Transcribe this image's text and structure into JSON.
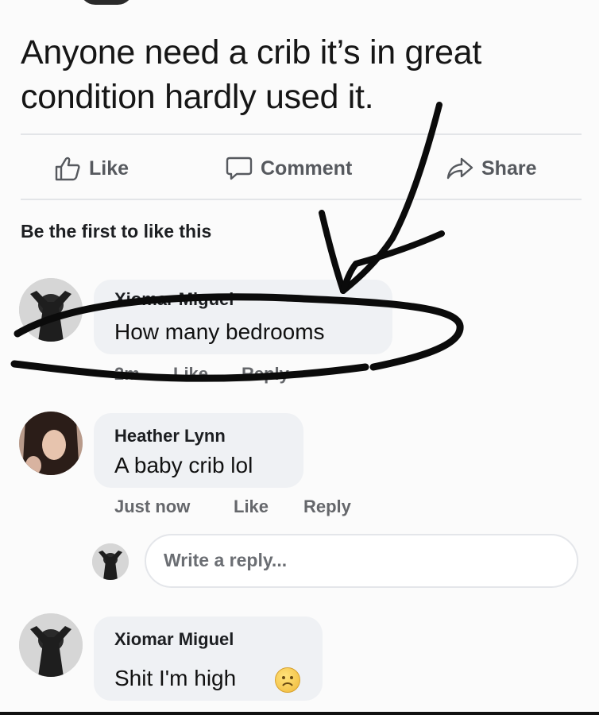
{
  "post": {
    "text": "Anyone need a crib it’s in great condition hardly used it."
  },
  "actions": {
    "like_label": "Like",
    "comment_label": "Comment",
    "share_label": "Share"
  },
  "reactions": {
    "summary": "Be the first to like this"
  },
  "comments": [
    {
      "author": "Xiomar Miguel",
      "text": "How many bedrooms",
      "time": "2m",
      "like_label": "Like",
      "reply_label": "Reply"
    },
    {
      "author": "Heather Lynn",
      "text": "A baby crib lol",
      "time": "Just now",
      "like_label": "Like",
      "reply_label": "Reply"
    },
    {
      "author": "Xiomar Miguel",
      "text": "Shit I'm high"
    }
  ],
  "reply_box": {
    "placeholder": "Write a reply..."
  },
  "icons": {
    "like": "thumbs-up-icon",
    "comment": "speech-bubble-icon",
    "share": "share-arrow-icon",
    "emoji": "sad-face-emoji-icon"
  },
  "colors": {
    "bubble": "#eff1f4",
    "meta_text": "#65676b",
    "annotation_ink": "#0b0b0b"
  }
}
